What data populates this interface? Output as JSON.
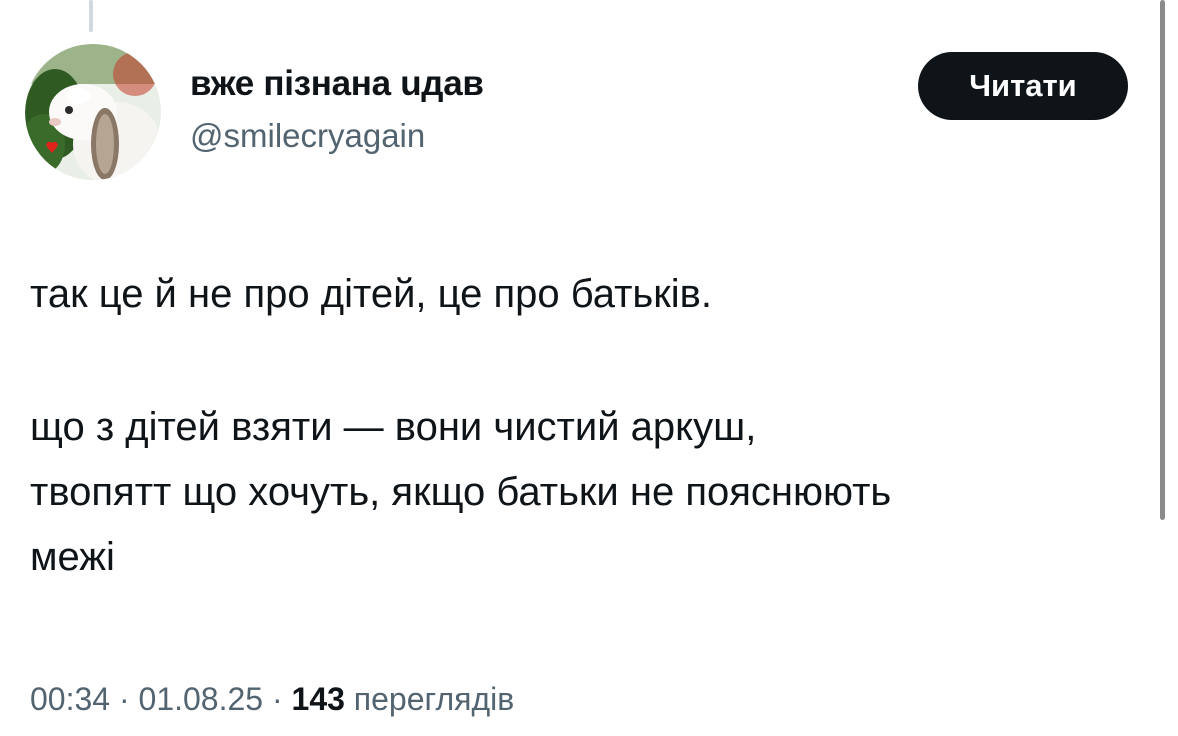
{
  "author": {
    "display_name": "вже пізнана uдaв",
    "handle": "@smilecryagain"
  },
  "follow_button": {
    "label": "Читати"
  },
  "tweet": {
    "lines": [
      "так це й не про дітей, це про батьків.",
      "що з дітей взяти — вони чистий аркуш,",
      "твопятт що хочуть, якщо батьки не пояснюють",
      "межі"
    ]
  },
  "meta": {
    "time": "00:34",
    "separator": "·",
    "date": "01.08.25",
    "views_count": "143",
    "views_label": "переглядів"
  },
  "colors": {
    "text_primary": "#0f1419",
    "text_secondary": "#536471",
    "button_bg": "#0f1419"
  },
  "icons": {
    "avatar": "white-rabbit-photo",
    "avatar_badge": "red-heart-icon"
  }
}
